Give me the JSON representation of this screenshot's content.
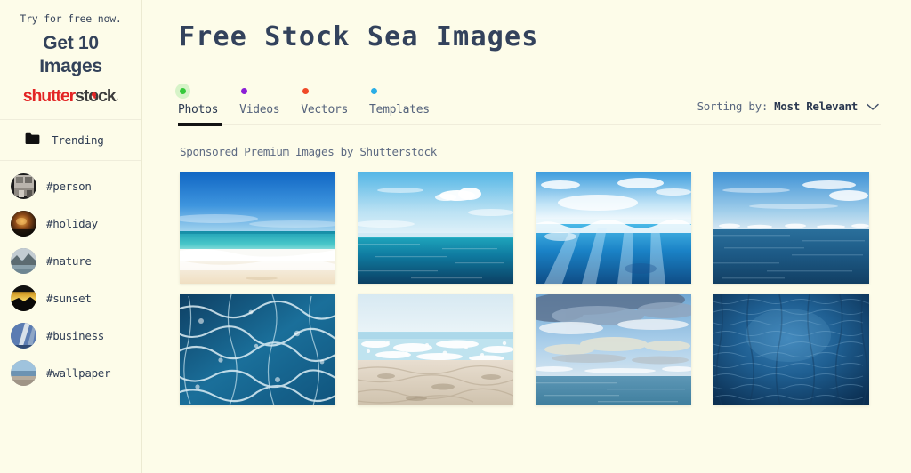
{
  "sidebar": {
    "promo": {
      "kicker": "Try for free now.",
      "headline_line1": "Get 10",
      "headline_line2": "Images",
      "logo": {
        "part_red": "shutter",
        "part_dark_pre": "st",
        "part_dark_o": "o",
        "part_dark_post": "ck",
        "trademark": "·"
      }
    },
    "trending": {
      "icon": "folder-icon",
      "label": "Trending"
    },
    "tags": [
      {
        "label": "#person",
        "thumb": "person-thumbnail"
      },
      {
        "label": "#holiday",
        "thumb": "holiday-thumbnail"
      },
      {
        "label": "#nature",
        "thumb": "nature-thumbnail"
      },
      {
        "label": "#sunset",
        "thumb": "sunset-thumbnail"
      },
      {
        "label": "#business",
        "thumb": "business-thumbnail"
      },
      {
        "label": "#wallpaper",
        "thumb": "wallpaper-thumbnail"
      }
    ]
  },
  "main": {
    "page_title": "Free Stock Sea Images",
    "tabs": [
      {
        "label": "Photos",
        "dot_color": "#35c93b",
        "active": true
      },
      {
        "label": "Videos",
        "dot_color": "#8b1fd6",
        "active": false
      },
      {
        "label": "Vectors",
        "dot_color": "#f04a28",
        "active": false
      },
      {
        "label": "Templates",
        "dot_color": "#2baee6",
        "active": false
      }
    ],
    "sorting": {
      "label": "Sorting by:",
      "value": "Most Relevant",
      "chevron": "chevron-down-icon"
    },
    "sponsored_note": "Sponsored Premium Images by Shutterstock",
    "images": [
      {
        "alt": "Tropical beach with turquoise water and white sand",
        "kind": "beach-turquoise"
      },
      {
        "alt": "Calm deep blue sea under a sky with scattered clouds",
        "kind": "open-sea-clouds"
      },
      {
        "alt": "Underwater view with sun rays piercing the blue water",
        "kind": "underwater-rays"
      },
      {
        "alt": "Wide open ocean horizon with blue sky",
        "kind": "ocean-horizon"
      },
      {
        "alt": "Dark blue churning sea foam texture from above",
        "kind": "foam-texture"
      },
      {
        "alt": "Sunlit sparkling sea shore with pale sand",
        "kind": "sparkling-shore"
      },
      {
        "alt": "Dramatic cloudy sky at dusk over a calm sea",
        "kind": "dusk-clouds-sea"
      },
      {
        "alt": "Deep blue rippled water surface texture",
        "kind": "rippled-water"
      }
    ]
  },
  "colors": {
    "background": "#fdfce9",
    "text": "#2c3e55",
    "accent_underline": "#131313",
    "logo_red": "#e32525",
    "logo_dark": "#3c3c3c"
  }
}
